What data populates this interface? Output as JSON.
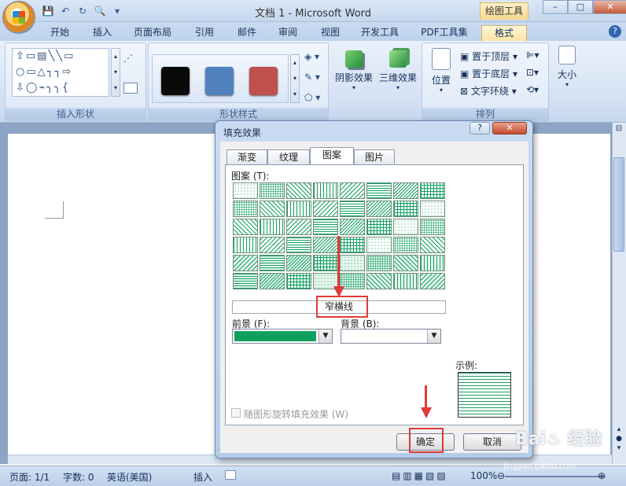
{
  "window": {
    "title": "文档 1 - Microsoft Word",
    "context_tab": "绘图工具",
    "min": "–",
    "max": "□",
    "close": "✕"
  },
  "qat": [
    "💾",
    "↶",
    "↻",
    "🔍",
    "▾"
  ],
  "tabs": [
    {
      "label": "开始"
    },
    {
      "label": "插入"
    },
    {
      "label": "页面布局"
    },
    {
      "label": "引用"
    },
    {
      "label": "邮件"
    },
    {
      "label": "审阅"
    },
    {
      "label": "视图"
    },
    {
      "label": "开发工具"
    },
    {
      "label": "PDF工具集"
    },
    {
      "label": "格式",
      "active": true
    }
  ],
  "help": "?",
  "ribbon": {
    "groups": {
      "insert_shapes": "插入形状",
      "shape_styles": "形状样式",
      "arrange": "排列"
    },
    "shapes_glyphs": "⇧▭▤╲╲▭ ○▭△┐┐⇨ ⇩◯⌁╮╮{",
    "swatch_colors": [
      "#0a0a0a",
      "#4f81bd",
      "#c0504d"
    ],
    "shadow_effect": "阴影效果",
    "three_d_effect": "三维效果",
    "position": "位置",
    "bring_front": "置于顶层",
    "send_back": "置于底层",
    "text_wrap": "文字环绕",
    "size": "大小"
  },
  "status": {
    "page": "页面: 1/1",
    "words": "字数: 0",
    "lang": "英语(美国)",
    "insert": "插入",
    "zoom": "100%"
  },
  "dialog": {
    "title": "填充效果",
    "help": "?",
    "close": "✕",
    "tabs": [
      {
        "label": "渐变"
      },
      {
        "label": "纹理"
      },
      {
        "label": "图案",
        "active": true
      },
      {
        "label": "图片"
      }
    ],
    "pattern_label": "图案 (T):",
    "selected_pattern": "窄横线",
    "foreground_label": "前景 (F):",
    "background_label": "背景 (B):",
    "foreground_color": "#0fa060",
    "background_color": "#ffffff",
    "sample_label": "示例:",
    "rotate_label": "随图形旋转填充效果 (W)",
    "ok": "确定",
    "cancel": "取消"
  },
  "watermark": {
    "brand": "Bai♨ 经验",
    "url": "jingyan.baidu.com"
  }
}
